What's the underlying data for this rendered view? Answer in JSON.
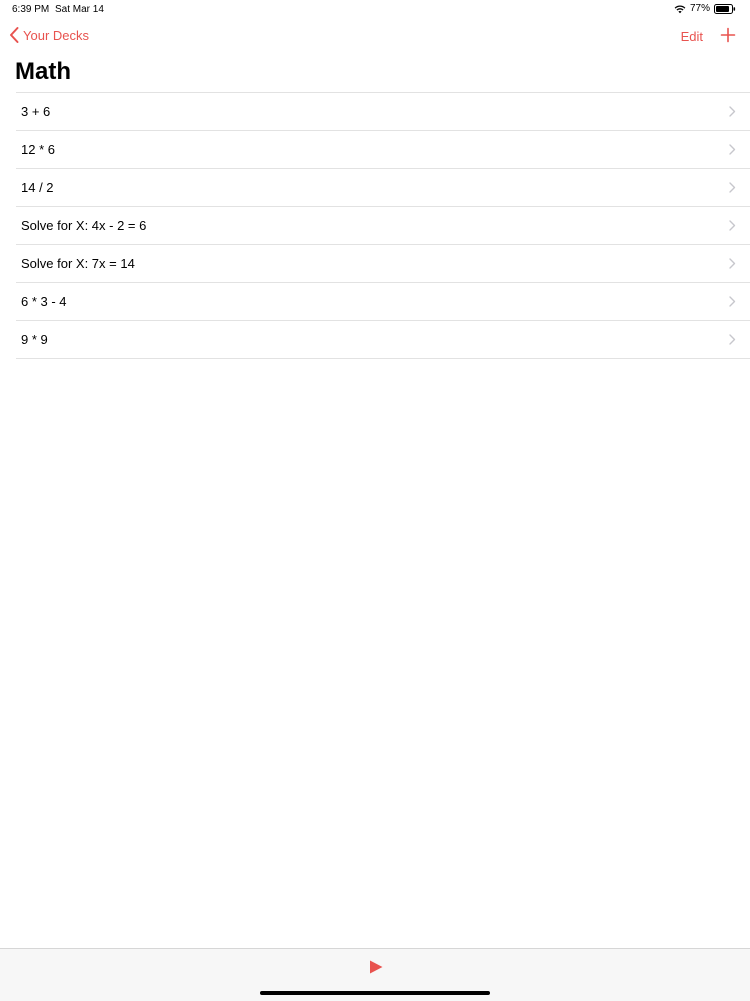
{
  "status_bar": {
    "time": "6:39 PM",
    "date": "Sat Mar 14",
    "battery": "77%"
  },
  "nav": {
    "back_label": "Your Decks",
    "edit_label": "Edit",
    "icons": {
      "back": "chevron-left-icon",
      "add": "plus-icon"
    }
  },
  "title": "Math",
  "cards": [
    {
      "label": "3 + 6"
    },
    {
      "label": "12 * 6"
    },
    {
      "label": "14 / 2"
    },
    {
      "label": "Solve for X: 4x - 2 = 6"
    },
    {
      "label": "Solve for X: 7x = 14"
    },
    {
      "label": "6 * 3 - 4"
    },
    {
      "label": "9 * 9"
    }
  ],
  "toolbar": {
    "icons": {
      "play": "play-icon"
    }
  },
  "colors": {
    "accent": "#e8534f",
    "separator": "#e2e2e2",
    "chevron": "#c7c7cc",
    "toolbar_bg": "#f7f7f7"
  }
}
